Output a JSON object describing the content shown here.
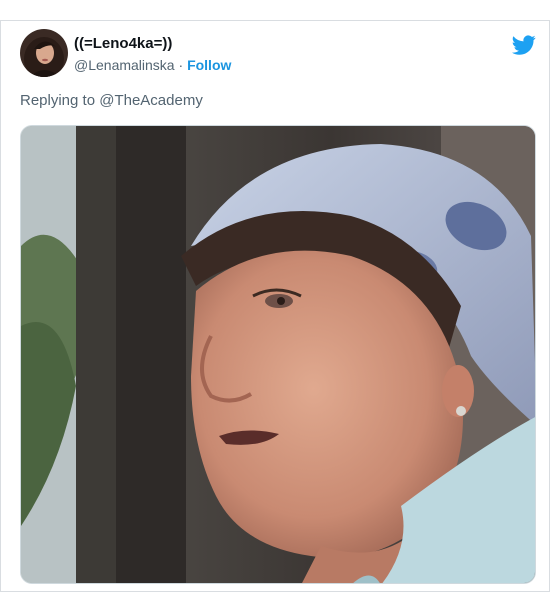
{
  "tweet": {
    "display_name": "((=Leno4ka=))",
    "handle": "@Lenamalinska",
    "separator": " · ",
    "follow_label": "Follow",
    "replying_prefix": "Replying to ",
    "replying_to": "@TheAcademy"
  },
  "colors": {
    "accent": "#1b95e0",
    "bird": "#1da1f2",
    "text_primary": "#0f1419",
    "text_secondary": "#536471",
    "border": "#d9dde1"
  },
  "icons": {
    "brand": "twitter-bird-icon"
  }
}
